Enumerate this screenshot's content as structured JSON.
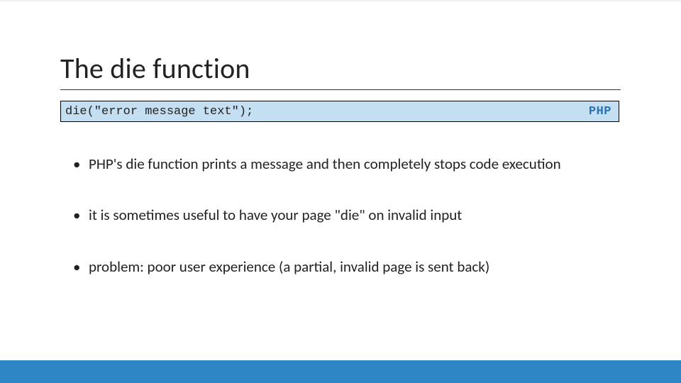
{
  "title": "The die function",
  "codebox": {
    "code": "die(\"error message text\");",
    "lang": "PHP"
  },
  "bullets": [
    "PHP's die function prints a message and then completely stops code execution",
    "it is sometimes useful to have your page \"die\" on invalid input",
    "problem: poor user experience (a partial, invalid page is sent back)"
  ],
  "colors": {
    "accent_bar": "#2e85c3",
    "code_bg": "#c5dff2",
    "lang_color": "#2e74b5"
  }
}
